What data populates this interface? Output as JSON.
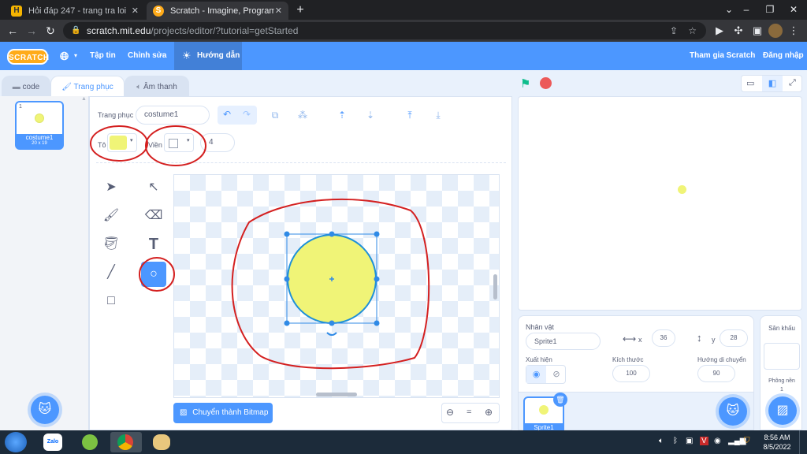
{
  "browser": {
    "tabs": [
      {
        "title": "Hỏi đáp 247 - trang tra loi",
        "favicon": "H"
      },
      {
        "title": "Scratch - Imagine, Program, Share",
        "favicon": "S"
      }
    ],
    "new_tab_icon": "plus-icon",
    "url_host": "scratch.mit.edu",
    "url_path": "/projects/editor/?tutorial=getStarted"
  },
  "menu": {
    "logo": "SCRATCH",
    "file": "Tập tin",
    "edit": "Chỉnh sửa",
    "tutorial": "Hướng dẫn",
    "join": "Tham gia Scratch",
    "signin": "Đăng nhập"
  },
  "tabs": {
    "code": "code",
    "costumes": "Trang phục",
    "sounds": "Âm thanh"
  },
  "costume_list": [
    {
      "index": "1",
      "name": "costume1",
      "size": "20 x 19"
    }
  ],
  "paint": {
    "costume_label": "Trang phục",
    "costume_name": "costume1",
    "fill_label": "Tô",
    "fill_color": "#f0f477",
    "outline_label": "Viền",
    "outline_width": "4",
    "convert_button": "Chuyển thành Bitmap",
    "zoom_reset": "="
  },
  "sprite_info": {
    "sprite_label": "Nhân vật",
    "sprite_name": "Sprite1",
    "x_label": "x",
    "x_value": "36",
    "y_label": "y",
    "y_value": "28",
    "show_label": "Xuất hiện",
    "size_label": "Kích thước",
    "size_value": "100",
    "direction_label": "Hướng di chuyển",
    "direction_value": "90"
  },
  "sprite_tile": {
    "name": "Sprite1"
  },
  "stage_panel": {
    "label": "Sân khấu",
    "backdrops_label": "Phông nền",
    "backdrops_count": "1"
  },
  "taskbar": {
    "zalo": "Zalo",
    "time": "8:56 AM",
    "date": "8/5/2022"
  },
  "colors": {
    "scratch_blue": "#4c97ff",
    "costume_fill": "#f0f477",
    "annotation_red": "#d42020"
  }
}
